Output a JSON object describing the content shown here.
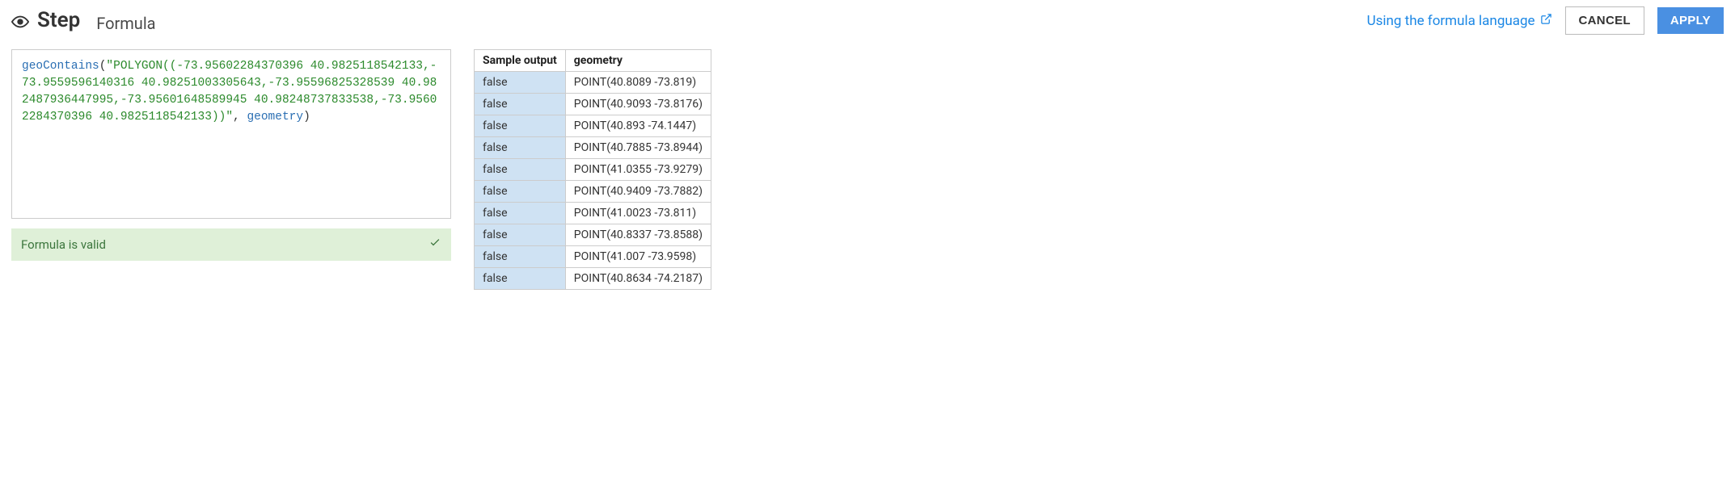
{
  "header": {
    "title": "Step",
    "subtitle": "Formula",
    "help_link_label": "Using the formula language",
    "cancel_label": "CANCEL",
    "apply_label": "APPLY"
  },
  "formula": {
    "function_name": "geoContains",
    "string_literal": "\"POLYGON((-73.95602284370396 40.9825118542133,-73.9559596140316 40.98251003305643,-73.95596825328539 40.982487936447995,-73.95601648589945 40.98248737833538,-73.95602284370396 40.9825118542133))\"",
    "identifier": "geometry",
    "status_message": "Formula is valid"
  },
  "preview": {
    "columns": [
      "Sample output",
      "geometry"
    ],
    "rows": [
      {
        "sample": "false",
        "geometry": "POINT(40.8089 -73.819)"
      },
      {
        "sample": "false",
        "geometry": "POINT(40.9093 -73.8176)"
      },
      {
        "sample": "false",
        "geometry": "POINT(40.893 -74.1447)"
      },
      {
        "sample": "false",
        "geometry": "POINT(40.7885 -73.8944)"
      },
      {
        "sample": "false",
        "geometry": "POINT(41.0355 -73.9279)"
      },
      {
        "sample": "false",
        "geometry": "POINT(40.9409 -73.7882)"
      },
      {
        "sample": "false",
        "geometry": "POINT(41.0023 -73.811)"
      },
      {
        "sample": "false",
        "geometry": "POINT(40.8337 -73.8588)"
      },
      {
        "sample": "false",
        "geometry": "POINT(41.007 -73.9598)"
      },
      {
        "sample": "false",
        "geometry": "POINT(40.8634 -74.2187)"
      }
    ]
  }
}
